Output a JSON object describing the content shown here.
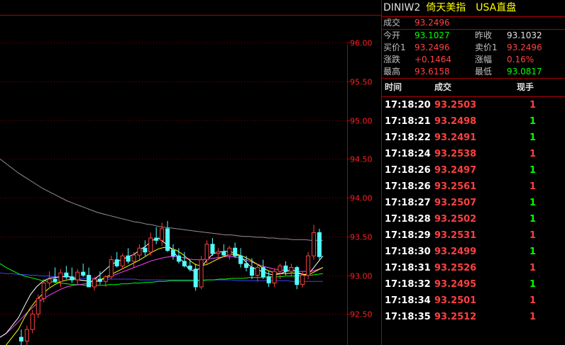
{
  "header": {
    "code": "DINIW2",
    "name": "倚天美指",
    "market": "USA直盘"
  },
  "quote": {
    "last_label": "成交",
    "last": "93.2496",
    "open_label": "今开",
    "open": "93.1027",
    "prev_close_label": "昨收",
    "prev_close": "93.1032",
    "bid_label": "买价1",
    "bid": "93.2496",
    "ask_label": "卖价1",
    "ask": "93.2496",
    "change_label": "涨跌",
    "change": "+0.1464",
    "change_pct_label": "涨幅",
    "change_pct": "0.16%",
    "high_label": "最高",
    "high": "93.6158",
    "low_label": "最低",
    "low": "93.0817"
  },
  "ticks_header": {
    "time": "时间",
    "price": "成交",
    "volume": "现手"
  },
  "ticks": [
    {
      "time": "17:18:20",
      "price": "93.2503",
      "volume": "1",
      "dir": "up"
    },
    {
      "time": "17:18:21",
      "price": "93.2498",
      "volume": "1",
      "dir": "down"
    },
    {
      "time": "17:18:22",
      "price": "93.2491",
      "volume": "1",
      "dir": "down"
    },
    {
      "time": "17:18:24",
      "price": "93.2538",
      "volume": "1",
      "dir": "up"
    },
    {
      "time": "17:18:26",
      "price": "93.2497",
      "volume": "1",
      "dir": "down"
    },
    {
      "time": "17:18:26",
      "price": "93.2561",
      "volume": "1",
      "dir": "up"
    },
    {
      "time": "17:18:27",
      "price": "93.2507",
      "volume": "1",
      "dir": "down"
    },
    {
      "time": "17:18:28",
      "price": "93.2502",
      "volume": "1",
      "dir": "down"
    },
    {
      "time": "17:18:29",
      "price": "93.2531",
      "volume": "1",
      "dir": "up"
    },
    {
      "time": "17:18:30",
      "price": "93.2499",
      "volume": "1",
      "dir": "down"
    },
    {
      "time": "17:18:31",
      "price": "93.2526",
      "volume": "1",
      "dir": "up"
    },
    {
      "time": "17:18:32",
      "price": "93.2495",
      "volume": "1",
      "dir": "down"
    },
    {
      "time": "17:18:34",
      "price": "93.2501",
      "volume": "1",
      "dir": "up"
    },
    {
      "time": "17:18:35",
      "price": "93.2512",
      "volume": "1",
      "dir": "up"
    }
  ],
  "colors": {
    "up": "#ff4040",
    "down": "#00ff00",
    "grid": "#800000",
    "axis_text": "#ff2020",
    "candle_up": "#ff4040",
    "candle_down": "#54ffff",
    "ma_short": "#ffffff",
    "ma_mid": "#ffff00",
    "ma_long1": "#ff40ff",
    "ma_long2": "#00ff00",
    "ma_long3": "#4040ff",
    "ma_longest": "#909090"
  },
  "chart_data": {
    "type": "candlestick",
    "y_ticks": [
      "96.00",
      "95.50",
      "95.00",
      "94.50",
      "94.00",
      "93.50",
      "93.00",
      "92.50"
    ],
    "y_range": [
      92.1,
      96.35
    ],
    "candles": [
      [
        92.2,
        92.3,
        92.1,
        92.15
      ],
      [
        92.15,
        92.35,
        92.1,
        92.3
      ],
      [
        92.3,
        92.55,
        92.25,
        92.5
      ],
      [
        92.5,
        92.75,
        92.45,
        92.7
      ],
      [
        92.7,
        92.95,
        92.65,
        92.9
      ],
      [
        92.9,
        93.05,
        92.85,
        92.95
      ],
      [
        92.95,
        93.1,
        92.9,
        92.92
      ],
      [
        92.92,
        93.08,
        92.85,
        93.03
      ],
      [
        93.03,
        93.12,
        92.95,
        92.98
      ],
      [
        92.98,
        93.1,
        92.9,
        92.94
      ],
      [
        92.94,
        93.08,
        92.88,
        93.04
      ],
      [
        93.04,
        93.15,
        92.98,
        93.0
      ],
      [
        93.0,
        93.1,
        92.9,
        92.85
      ],
      [
        92.85,
        92.98,
        92.8,
        92.95
      ],
      [
        92.95,
        93.05,
        92.88,
        92.92
      ],
      [
        92.92,
        93.0,
        92.85,
        92.98
      ],
      [
        92.98,
        93.25,
        92.95,
        93.2
      ],
      [
        93.2,
        93.3,
        93.1,
        93.12
      ],
      [
        93.12,
        93.28,
        93.08,
        93.25
      ],
      [
        93.25,
        93.35,
        93.15,
        93.18
      ],
      [
        93.18,
        93.3,
        93.1,
        93.26
      ],
      [
        93.26,
        93.4,
        93.2,
        93.35
      ],
      [
        93.35,
        93.45,
        93.25,
        93.3
      ],
      [
        93.3,
        93.55,
        93.25,
        93.48
      ],
      [
        93.48,
        93.62,
        93.4,
        93.45
      ],
      [
        93.45,
        93.68,
        93.38,
        93.6
      ],
      [
        93.6,
        93.7,
        93.3,
        93.32
      ],
      [
        93.32,
        93.4,
        93.2,
        93.25
      ],
      [
        93.25,
        93.35,
        93.15,
        93.18
      ],
      [
        93.18,
        93.3,
        93.1,
        93.12
      ],
      [
        93.12,
        93.2,
        93.05,
        93.08
      ],
      [
        93.08,
        93.15,
        92.8,
        92.85
      ],
      [
        92.85,
        93.25,
        92.82,
        93.2
      ],
      [
        93.2,
        93.45,
        93.15,
        93.4
      ],
      [
        93.4,
        93.48,
        93.25,
        93.28
      ],
      [
        93.28,
        93.35,
        93.2,
        93.3
      ],
      [
        93.3,
        93.4,
        93.25,
        93.26
      ],
      [
        93.26,
        93.38,
        93.2,
        93.35
      ],
      [
        93.35,
        93.42,
        93.22,
        93.25
      ],
      [
        93.25,
        93.35,
        93.1,
        93.15
      ],
      [
        93.15,
        93.25,
        93.05,
        93.1
      ],
      [
        93.1,
        93.22,
        92.95,
        93.0
      ],
      [
        93.0,
        93.15,
        92.92,
        93.1
      ],
      [
        93.1,
        93.2,
        92.95,
        92.98
      ],
      [
        92.98,
        93.05,
        92.85,
        92.9
      ],
      [
        92.9,
        93.08,
        92.85,
        93.05
      ],
      [
        93.05,
        93.15,
        92.95,
        93.12
      ],
      [
        93.12,
        93.18,
        93.0,
        93.05
      ],
      [
        93.05,
        93.15,
        92.98,
        93.1
      ],
      [
        93.1,
        93.12,
        92.82,
        92.88
      ],
      [
        92.88,
        93.05,
        92.84,
        93.0
      ],
      [
        93.0,
        93.3,
        92.95,
        93.25
      ],
      [
        93.25,
        93.65,
        93.2,
        93.55
      ],
      [
        93.55,
        93.6,
        93.2,
        93.24
      ]
    ],
    "ma_short": [
      92.2,
      92.25,
      92.35,
      92.45,
      92.6,
      92.75,
      92.85,
      92.92,
      92.96,
      92.97,
      92.98,
      92.99,
      92.97,
      92.94,
      92.93,
      92.92,
      92.98,
      93.05,
      93.12,
      93.17,
      93.2,
      93.24,
      93.27,
      93.33,
      93.38,
      93.45,
      93.48,
      93.42,
      93.35,
      93.25,
      93.18,
      93.08,
      93.05,
      93.1,
      93.2,
      93.28,
      93.3,
      93.31,
      93.3,
      93.26,
      93.2,
      93.12,
      93.08,
      93.05,
      93.02,
      93.0,
      93.02,
      93.05,
      93.07,
      93.03,
      93.0,
      93.05,
      93.15,
      93.25
    ],
    "ma_mid": [
      92.0,
      92.1,
      92.2,
      92.3,
      92.45,
      92.58,
      92.68,
      92.76,
      92.83,
      92.88,
      92.92,
      92.94,
      92.95,
      92.94,
      92.93,
      92.92,
      92.93,
      92.96,
      93.0,
      93.04,
      93.08,
      93.12,
      93.16,
      93.2,
      93.25,
      93.3,
      93.34,
      93.36,
      93.35,
      93.32,
      93.27,
      93.2,
      93.14,
      93.12,
      93.14,
      93.18,
      93.22,
      93.25,
      93.27,
      93.27,
      93.24,
      93.2,
      93.15,
      93.1,
      93.06,
      93.03,
      93.02,
      93.02,
      93.03,
      93.02,
      93.01,
      93.02,
      93.06,
      93.1
    ],
    "ma_long1": [
      92.2,
      92.25,
      92.32,
      92.4,
      92.48,
      92.56,
      92.63,
      92.69,
      92.74,
      92.78,
      92.82,
      92.85,
      92.87,
      92.88,
      92.89,
      92.9,
      92.92,
      92.95,
      92.98,
      93.01,
      93.04,
      93.07,
      93.1,
      93.13,
      93.16,
      93.19,
      93.21,
      93.23,
      93.24,
      93.24,
      93.23,
      93.21,
      93.2,
      93.2,
      93.21,
      93.22,
      93.23,
      93.24,
      93.24,
      93.23,
      93.21,
      93.18,
      93.15,
      93.12,
      93.1,
      93.08,
      93.07,
      93.06,
      93.06,
      93.05,
      93.05,
      93.05,
      93.07,
      93.1
    ],
    "ma_long2": [
      93.15,
      93.1,
      93.06,
      93.02,
      92.99,
      92.97,
      92.95,
      92.93,
      92.92,
      92.91,
      92.9,
      92.89,
      92.88,
      92.88,
      92.87,
      92.87,
      92.87,
      92.87,
      92.88,
      92.88,
      92.89,
      92.89,
      92.9,
      92.9,
      92.91,
      92.91,
      92.92,
      92.92,
      92.93,
      92.93,
      92.93,
      92.93,
      92.93,
      92.93,
      92.94,
      92.94,
      92.95,
      92.95,
      92.96,
      92.96,
      92.96,
      92.97,
      92.97,
      92.97,
      92.98,
      92.98,
      92.98,
      92.99,
      92.99,
      92.99,
      93.0,
      93.0,
      93.01,
      93.02
    ],
    "ma_long3": [
      93.03,
      93.02,
      93.02,
      93.01,
      93.01,
      93.0,
      93.0,
      92.99,
      92.99,
      92.98,
      92.98,
      92.97,
      92.97,
      92.96,
      92.96,
      92.96,
      92.95,
      92.95,
      92.95,
      92.95,
      92.95,
      92.95,
      92.95,
      92.94,
      92.94,
      92.94,
      92.94,
      92.94,
      92.94,
      92.94,
      92.94,
      92.94,
      92.94,
      92.94,
      92.94,
      92.94,
      92.94,
      92.94,
      92.94,
      92.93,
      92.93,
      92.93,
      92.93,
      92.93,
      92.93,
      92.93,
      92.93,
      92.93,
      92.92,
      92.92,
      92.92,
      92.92,
      92.92,
      92.92
    ],
    "ma_longest": [
      94.5,
      94.44,
      94.38,
      94.32,
      94.27,
      94.22,
      94.17,
      94.12,
      94.08,
      94.04,
      94.0,
      93.96,
      93.93,
      93.9,
      93.87,
      93.84,
      93.81,
      93.79,
      93.77,
      93.75,
      93.73,
      93.71,
      93.69,
      93.68,
      93.66,
      93.65,
      93.63,
      93.62,
      93.61,
      93.6,
      93.59,
      93.58,
      93.57,
      93.56,
      93.55,
      93.54,
      93.53,
      93.52,
      93.52,
      93.51,
      93.5,
      93.5,
      93.49,
      93.49,
      93.48,
      93.48,
      93.47,
      93.47,
      93.46,
      93.46,
      93.46,
      93.45,
      93.45,
      93.45
    ]
  }
}
